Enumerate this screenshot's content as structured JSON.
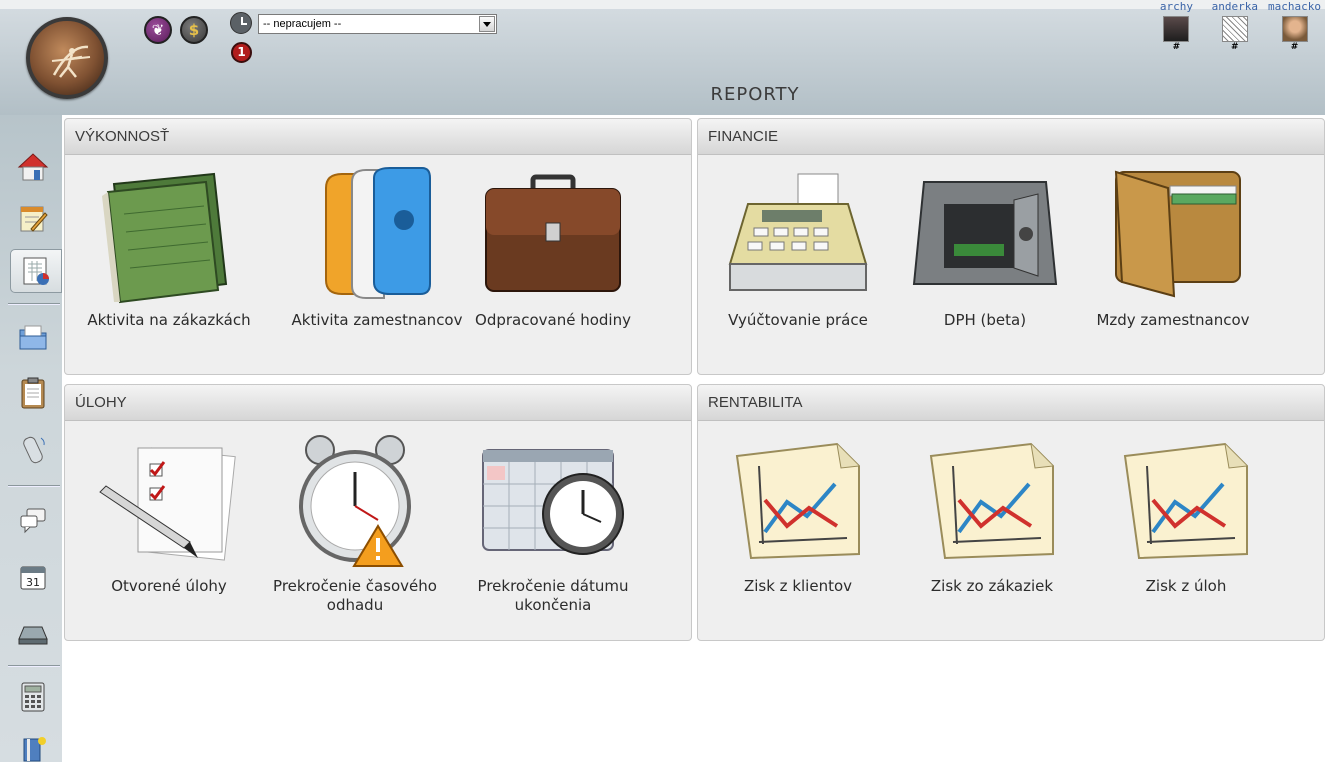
{
  "header": {
    "title": "REPORTY",
    "activity_select": "-- nepracujem --",
    "notification_count": "1",
    "buttons": {
      "lotus_icon": "lotus-icon",
      "dollar_symbol": "$"
    }
  },
  "users": [
    {
      "name": "archy",
      "hash": "#"
    },
    {
      "name": "anderka",
      "hash": "#"
    },
    {
      "name": "machacko",
      "hash": "#"
    }
  ],
  "sidebar": {
    "items": [
      "home-icon",
      "notepad-icon",
      "reports-icon",
      "folder-icon",
      "clipboard-icon",
      "phone-icon",
      "chat-icon",
      "calendar-icon",
      "tray-icon",
      "calculator-icon",
      "book-icon"
    ],
    "calendar_day": "31",
    "active_item": "reports-icon"
  },
  "panels": {
    "vykonnost": {
      "title": "VÝKONNOSŤ",
      "tiles": [
        {
          "label": "Aktivita na zákazkách",
          "icon": "folder-icon"
        },
        {
          "label": "Aktivita zamestnancov",
          "icon": "people-icon"
        },
        {
          "label": "Odpracované hodiny",
          "icon": "briefcase-icon"
        }
      ]
    },
    "financie": {
      "title": "FINANCIE",
      "tiles": [
        {
          "label": "Vyúčtovanie práce",
          "icon": "cash-register-icon"
        },
        {
          "label": "DPH (beta)",
          "icon": "safe-icon"
        },
        {
          "label": "Mzdy zamestnancov",
          "icon": "wallet-icon"
        }
      ]
    },
    "ulohy": {
      "title": "ÚLOHY",
      "tiles": [
        {
          "label": "Otvorené úlohy",
          "icon": "checklist-icon"
        },
        {
          "label": "Prekročenie časového odhadu",
          "icon": "alarm-clock-warning-icon"
        },
        {
          "label": "Prekročenie dátumu ukončenia",
          "icon": "calendar-clock-icon"
        }
      ]
    },
    "rentabilita": {
      "title": "RENTABILITA",
      "tiles": [
        {
          "label": "Zisk z klientov",
          "icon": "chart-icon"
        },
        {
          "label": "Zisk zo zákaziek",
          "icon": "chart-icon"
        },
        {
          "label": "Zisk z úloh",
          "icon": "chart-icon"
        }
      ]
    }
  }
}
